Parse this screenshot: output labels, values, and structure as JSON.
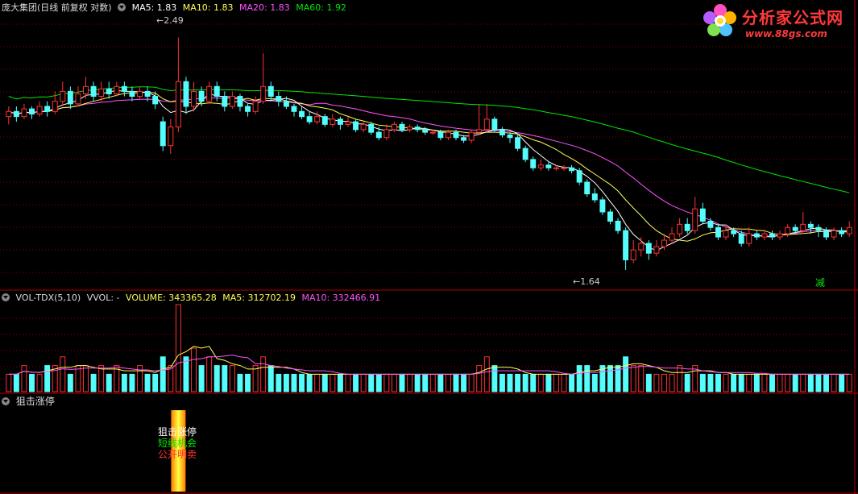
{
  "header": {
    "title": "庞大集团(日线 前复权 对数)",
    "ma5": "MA5: 1.83",
    "ma10": "MA10: 1.83",
    "ma20": "MA20: 1.83",
    "ma60": "MA60: 1.92"
  },
  "volume_header": {
    "name": "VOL-TDX(5,10)",
    "vvol": "VVOL: -",
    "volume": "VOLUME: 343365.28",
    "ma5": "MA5: 312702.19",
    "ma10": "MA10: 332466.91"
  },
  "indicator_header": {
    "name": "狙击涨停"
  },
  "indicator_labels": [
    "狙击涨停",
    "短线机会",
    "公开明卖"
  ],
  "annotations": {
    "high": "2.49",
    "low": "1.64",
    "marker": "减"
  },
  "logo": {
    "title": "分析家公式网",
    "url": "www.88gs.com"
  },
  "colors": {
    "up": "#ff3232",
    "down": "#54fcfc",
    "ma5": "#ffffff",
    "ma10": "#ffff54",
    "ma20": "#ff54ff",
    "ma60": "#00e600",
    "grid": "#8b0000",
    "border": "#b00000"
  },
  "chart_data": {
    "type": "candlestick",
    "scale": "log",
    "price_range": [
      1.6,
      2.55
    ],
    "series": [
      {
        "name": "MA5",
        "value": 1.83
      },
      {
        "name": "MA10",
        "value": 1.83
      },
      {
        "name": "MA20",
        "value": 1.83
      },
      {
        "name": "MA60",
        "value": 1.92
      }
    ],
    "high_mark": 2.49,
    "low_mark": 1.64,
    "candles": [
      [
        2.16,
        2.18,
        2.2,
        2.13
      ],
      [
        2.18,
        2.16,
        2.2,
        2.14
      ],
      [
        2.16,
        2.19,
        2.21,
        2.15
      ],
      [
        2.19,
        2.17,
        2.2,
        2.15
      ],
      [
        2.17,
        2.2,
        2.22,
        2.16
      ],
      [
        2.2,
        2.18,
        2.22,
        2.16
      ],
      [
        2.18,
        2.22,
        2.26,
        2.17
      ],
      [
        2.22,
        2.26,
        2.3,
        2.2
      ],
      [
        2.26,
        2.21,
        2.28,
        2.19
      ],
      [
        2.21,
        2.25,
        2.28,
        2.2
      ],
      [
        2.25,
        2.28,
        2.32,
        2.23
      ],
      [
        2.28,
        2.24,
        2.3,
        2.22
      ],
      [
        2.24,
        2.27,
        2.3,
        2.22
      ],
      [
        2.27,
        2.25,
        2.3,
        2.23
      ],
      [
        2.25,
        2.28,
        2.3,
        2.24
      ],
      [
        2.28,
        2.26,
        2.3,
        2.24
      ],
      [
        2.26,
        2.24,
        2.28,
        2.22
      ],
      [
        2.24,
        2.26,
        2.28,
        2.23
      ],
      [
        2.26,
        2.24,
        2.28,
        2.22
      ],
      [
        2.24,
        2.21,
        2.26,
        2.19
      ],
      [
        2.14,
        2.05,
        2.16,
        2.03
      ],
      [
        2.05,
        2.12,
        2.15,
        2.02
      ],
      [
        2.12,
        2.3,
        2.49,
        2.1
      ],
      [
        2.3,
        2.2,
        2.32,
        2.17
      ],
      [
        2.2,
        2.26,
        2.3,
        2.18
      ],
      [
        2.26,
        2.22,
        2.28,
        2.2
      ],
      [
        2.22,
        2.28,
        2.3,
        2.21
      ],
      [
        2.28,
        2.24,
        2.3,
        2.22
      ],
      [
        2.24,
        2.2,
        2.26,
        2.18
      ],
      [
        2.2,
        2.24,
        2.26,
        2.19
      ],
      [
        2.24,
        2.2,
        2.25,
        2.18
      ],
      [
        2.2,
        2.18,
        2.21,
        2.16
      ],
      [
        2.18,
        2.22,
        2.24,
        2.17
      ],
      [
        2.22,
        2.28,
        2.42,
        2.21
      ],
      [
        2.28,
        2.24,
        2.3,
        2.22
      ],
      [
        2.24,
        2.22,
        2.26,
        2.2
      ],
      [
        2.22,
        2.2,
        2.24,
        2.19
      ],
      [
        2.2,
        2.18,
        2.21,
        2.16
      ],
      [
        2.18,
        2.16,
        2.2,
        2.15
      ],
      [
        2.16,
        2.14,
        2.18,
        2.13
      ],
      [
        2.14,
        2.16,
        2.18,
        2.13
      ],
      [
        2.16,
        2.13,
        2.17,
        2.12
      ],
      [
        2.13,
        2.15,
        2.17,
        2.12
      ],
      [
        2.15,
        2.13,
        2.16,
        2.11
      ],
      [
        2.13,
        2.14,
        2.16,
        2.12
      ],
      [
        2.14,
        2.11,
        2.15,
        2.1
      ],
      [
        2.11,
        2.13,
        2.14,
        2.1
      ],
      [
        2.13,
        2.1,
        2.14,
        2.09
      ],
      [
        2.1,
        2.08,
        2.12,
        2.07
      ],
      [
        2.08,
        2.11,
        2.13,
        2.07
      ],
      [
        2.11,
        2.13,
        2.14,
        2.1
      ],
      [
        2.13,
        2.11,
        2.14,
        2.1
      ],
      [
        2.11,
        2.12,
        2.13,
        2.1
      ],
      [
        2.12,
        2.11,
        2.13,
        2.1
      ],
      [
        2.11,
        2.1,
        2.12,
        2.09
      ],
      [
        2.1,
        2.1,
        2.11,
        2.09
      ],
      [
        2.1,
        2.08,
        2.11,
        2.07
      ],
      [
        2.08,
        2.1,
        2.11,
        2.07
      ],
      [
        2.1,
        2.08,
        2.11,
        2.07
      ],
      [
        2.08,
        2.07,
        2.09,
        2.06
      ],
      [
        2.07,
        2.1,
        2.11,
        2.06
      ],
      [
        2.1,
        2.11,
        2.21,
        2.09
      ],
      [
        2.11,
        2.15,
        2.21,
        2.1
      ],
      [
        2.15,
        2.11,
        2.16,
        2.1
      ],
      [
        2.11,
        2.09,
        2.12,
        2.08
      ],
      [
        2.09,
        2.08,
        2.1,
        2.06
      ],
      [
        2.08,
        2.04,
        2.09,
        2.03
      ],
      [
        2.04,
        2.0,
        2.05,
        1.99
      ],
      [
        2.0,
        1.97,
        2.01,
        1.96
      ],
      [
        1.97,
        1.98,
        2.0,
        1.96
      ],
      [
        1.98,
        1.97,
        1.99,
        1.96
      ],
      [
        1.97,
        1.97,
        1.98,
        1.96
      ],
      [
        1.97,
        1.97,
        1.98,
        1.96
      ],
      [
        1.97,
        1.96,
        1.98,
        1.95
      ],
      [
        1.96,
        1.92,
        1.97,
        1.91
      ],
      [
        1.92,
        1.88,
        1.93,
        1.87
      ],
      [
        1.88,
        1.86,
        1.9,
        1.85
      ],
      [
        1.86,
        1.82,
        1.87,
        1.81
      ],
      [
        1.82,
        1.79,
        1.83,
        1.78
      ],
      [
        1.79,
        1.76,
        1.8,
        1.75
      ],
      [
        1.76,
        1.67,
        1.77,
        1.64
      ],
      [
        1.67,
        1.7,
        1.73,
        1.66
      ],
      [
        1.7,
        1.72,
        1.74,
        1.68
      ],
      [
        1.72,
        1.69,
        1.73,
        1.67
      ],
      [
        1.69,
        1.71,
        1.73,
        1.68
      ],
      [
        1.71,
        1.73,
        1.75,
        1.7
      ],
      [
        1.73,
        1.75,
        1.77,
        1.72
      ],
      [
        1.75,
        1.78,
        1.8,
        1.74
      ],
      [
        1.78,
        1.76,
        1.8,
        1.75
      ],
      [
        1.76,
        1.83,
        1.87,
        1.75
      ],
      [
        1.83,
        1.79,
        1.85,
        1.78
      ],
      [
        1.79,
        1.77,
        1.8,
        1.76
      ],
      [
        1.77,
        1.74,
        1.78,
        1.73
      ],
      [
        1.74,
        1.76,
        1.78,
        1.73
      ],
      [
        1.76,
        1.75,
        1.77,
        1.74
      ],
      [
        1.75,
        1.72,
        1.76,
        1.71
      ],
      [
        1.72,
        1.75,
        1.77,
        1.71
      ],
      [
        1.75,
        1.74,
        1.76,
        1.73
      ],
      [
        1.74,
        1.75,
        1.76,
        1.73
      ],
      [
        1.75,
        1.74,
        1.76,
        1.73
      ],
      [
        1.74,
        1.75,
        1.76,
        1.73
      ],
      [
        1.75,
        1.77,
        1.78,
        1.74
      ],
      [
        1.77,
        1.76,
        1.78,
        1.75
      ],
      [
        1.76,
        1.78,
        1.82,
        1.75
      ],
      [
        1.78,
        1.77,
        1.79,
        1.75
      ],
      [
        1.77,
        1.76,
        1.78,
        1.74
      ],
      [
        1.76,
        1.74,
        1.77,
        1.73
      ],
      [
        1.74,
        1.76,
        1.77,
        1.73
      ],
      [
        1.76,
        1.75,
        1.77,
        1.74
      ],
      [
        1.75,
        1.77,
        1.79,
        1.74
      ]
    ],
    "volume": [
      2,
      2,
      3,
      2,
      2,
      3,
      3,
      4,
      2,
      3,
      3,
      2,
      3,
      2,
      3,
      2,
      2,
      3,
      2,
      2,
      4,
      3,
      10,
      4,
      5,
      3,
      4,
      3,
      3,
      3,
      2,
      2,
      3,
      4,
      3,
      2,
      2,
      2,
      2,
      2,
      2,
      2,
      2,
      2,
      2,
      2,
      2,
      2,
      2,
      2,
      2,
      2,
      2,
      2,
      2,
      2,
      2,
      2,
      2,
      2,
      2,
      3,
      4,
      3,
      2,
      2,
      2,
      2,
      2,
      2,
      2,
      2,
      2,
      2,
      3,
      3,
      2,
      3,
      3,
      3,
      4,
      3,
      3,
      2,
      2,
      2,
      2,
      3,
      2,
      3,
      2,
      2,
      2,
      2,
      2,
      2,
      2,
      2,
      2,
      2,
      2,
      2,
      2,
      2,
      2,
      2,
      2,
      2,
      2,
      2
    ]
  }
}
